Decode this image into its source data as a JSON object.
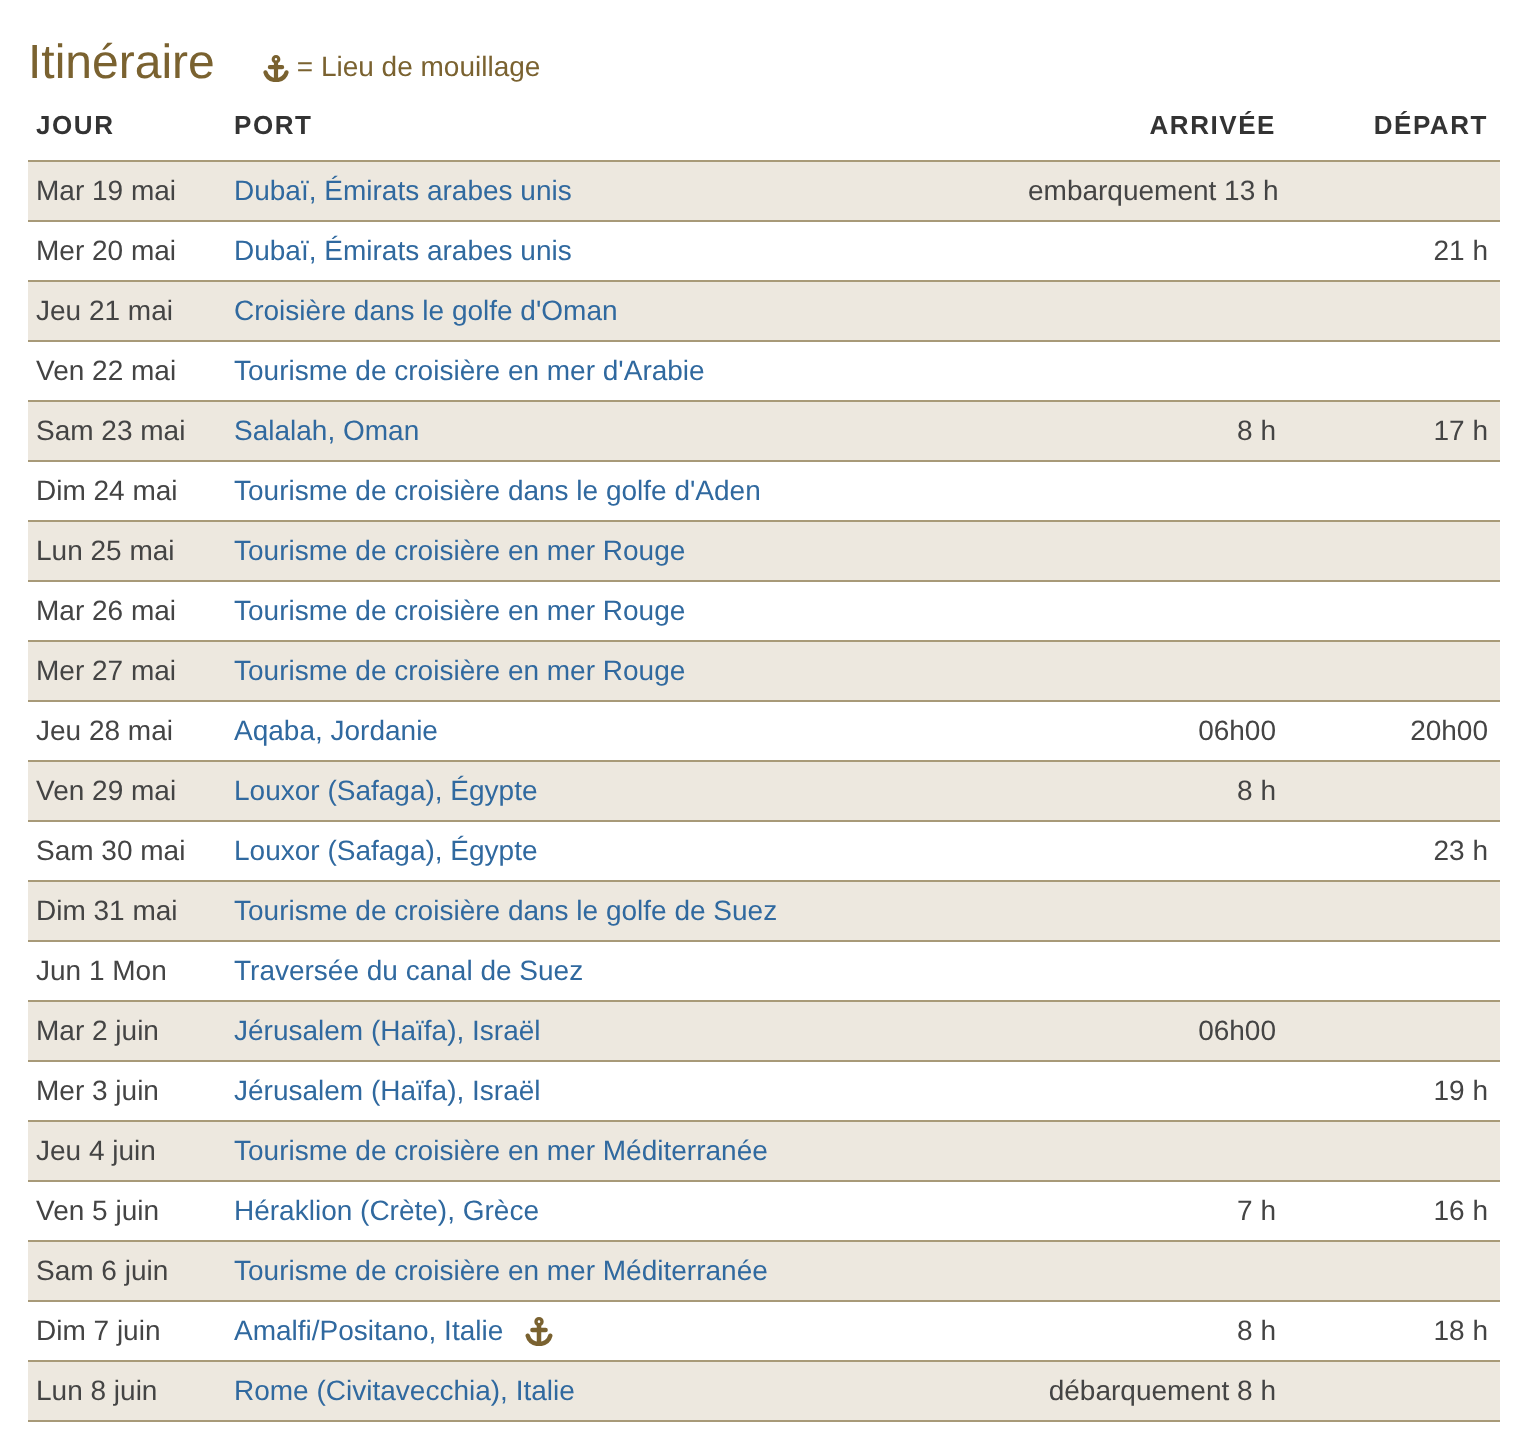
{
  "title": "Itinéraire",
  "legend": {
    "text": "= Lieu de mouillage"
  },
  "columns": [
    "JOUR",
    "PORT",
    "ARRIVÉE",
    "DÉPART"
  ],
  "rows": [
    {
      "day": "Mar 19 mai",
      "port": "Dubaï, Émirats arabes unis",
      "arrival": "embarquement 13 h",
      "departure": "",
      "anchorage": false
    },
    {
      "day": "Mer 20 mai",
      "port": "Dubaï, Émirats arabes unis",
      "arrival": "",
      "departure": "21 h",
      "anchorage": false
    },
    {
      "day": "Jeu 21 mai",
      "port": "Croisière dans le golfe d'Oman",
      "arrival": "",
      "departure": "",
      "anchorage": false
    },
    {
      "day": "Ven 22 mai",
      "port": "Tourisme de croisière en mer d'Arabie",
      "arrival": "",
      "departure": "",
      "anchorage": false
    },
    {
      "day": "Sam 23 mai",
      "port": "Salalah, Oman",
      "arrival": "8 h",
      "departure": "17 h",
      "anchorage": false
    },
    {
      "day": "Dim 24 mai",
      "port": "Tourisme de croisière dans le golfe d'Aden",
      "arrival": "",
      "departure": "",
      "anchorage": false
    },
    {
      "day": "Lun 25 mai",
      "port": "Tourisme de croisière en mer Rouge",
      "arrival": "",
      "departure": "",
      "anchorage": false
    },
    {
      "day": "Mar 26 mai",
      "port": "Tourisme de croisière en mer Rouge",
      "arrival": "",
      "departure": "",
      "anchorage": false
    },
    {
      "day": "Mer 27 mai",
      "port": "Tourisme de croisière en mer Rouge",
      "arrival": "",
      "departure": "",
      "anchorage": false
    },
    {
      "day": "Jeu 28 mai",
      "port": "Aqaba, Jordanie",
      "arrival": "06h00",
      "departure": "20h00",
      "anchorage": false
    },
    {
      "day": "Ven 29 mai",
      "port": "Louxor (Safaga), Égypte",
      "arrival": "8 h",
      "departure": "",
      "anchorage": false
    },
    {
      "day": "Sam 30 mai",
      "port": "Louxor (Safaga), Égypte",
      "arrival": "",
      "departure": "23 h",
      "anchorage": false
    },
    {
      "day": "Dim 31 mai",
      "port": "Tourisme de croisière dans le golfe de Suez",
      "arrival": "",
      "departure": "",
      "anchorage": false
    },
    {
      "day": "Jun 1 Mon",
      "port": "Traversée du canal de Suez",
      "arrival": "",
      "departure": "",
      "anchorage": false
    },
    {
      "day": "Mar 2 juin",
      "port": "Jérusalem (Haïfa), Israël",
      "arrival": "06h00",
      "departure": "",
      "anchorage": false
    },
    {
      "day": "Mer 3 juin",
      "port": "Jérusalem (Haïfa), Israël",
      "arrival": "",
      "departure": "19 h",
      "anchorage": false
    },
    {
      "day": "Jeu 4 juin",
      "port": "Tourisme de croisière en mer Méditerranée",
      "arrival": "",
      "departure": "",
      "anchorage": false
    },
    {
      "day": "Ven 5 juin",
      "port": "Héraklion (Crète), Grèce",
      "arrival": "7 h",
      "departure": "16 h",
      "anchorage": false
    },
    {
      "day": "Sam 6 juin",
      "port": "Tourisme de croisière en mer Méditerranée",
      "arrival": "",
      "departure": "",
      "anchorage": false
    },
    {
      "day": "Dim 7 juin",
      "port": "Amalfi/Positano, Italie",
      "arrival": "8 h",
      "departure": "18 h",
      "anchorage": true
    },
    {
      "day": "Lun 8 juin",
      "port": "Rome (Civitavecchia), Italie",
      "arrival": "débarquement 8 h",
      "departure": "",
      "anchorage": false
    }
  ]
}
